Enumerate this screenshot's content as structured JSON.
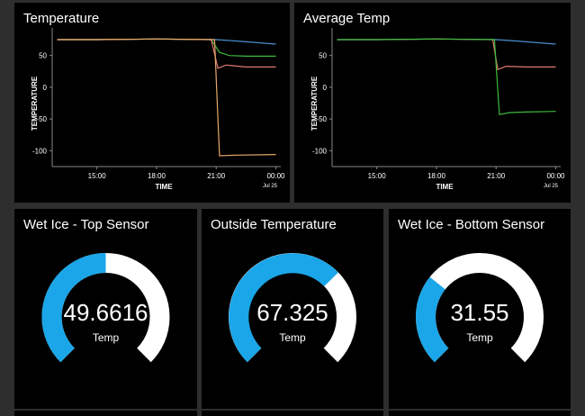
{
  "colors": {
    "background": "#000000",
    "gauge_fill": "#1aa6e8",
    "gauge_track": "#ffffff",
    "series_blue": "#4a8fd1",
    "series_green": "#3dbb3d",
    "series_red": "#e07a72",
    "series_orange": "#e8a86a"
  },
  "charts": [
    {
      "title": "Temperature",
      "xlabel": "TIME",
      "ylabel": "TEMPERATURE",
      "date_label": "Jul 25"
    },
    {
      "title": "Average Temp",
      "xlabel": "TIME",
      "ylabel": "TEMPERATURE",
      "date_label": "Jul 25"
    }
  ],
  "chart_data": [
    {
      "type": "line",
      "title": "Temperature",
      "xlabel": "TIME",
      "ylabel": "TEMPERATURE",
      "x_ticks": [
        "15:00",
        "18:00",
        "21:00",
        "00:00"
      ],
      "x_date_label": "Jul 25",
      "xlim": [
        "12:45",
        "00:15"
      ],
      "y_ticks": [
        50,
        0,
        -50,
        -100
      ],
      "ylim": [
        -125,
        85
      ],
      "grid": false,
      "series": [
        {
          "color": "#4a8fd1",
          "points": [
            [
              "13:00",
              75
            ],
            [
              "15:00",
              75
            ],
            [
              "18:00",
              76
            ],
            [
              "21:00",
              75
            ],
            [
              "22:00",
              73
            ],
            [
              "00:00",
              68
            ]
          ]
        },
        {
          "color": "#3dbb3d",
          "points": [
            [
              "13:00",
              75
            ],
            [
              "15:00",
              75
            ],
            [
              "18:00",
              76
            ],
            [
              "20:45",
              75
            ],
            [
              "21:10",
              55
            ],
            [
              "21:40",
              50
            ],
            [
              "22:30",
              49
            ],
            [
              "00:00",
              49
            ]
          ]
        },
        {
          "color": "#e07a72",
          "points": [
            [
              "13:00",
              75
            ],
            [
              "15:00",
              75
            ],
            [
              "18:00",
              76
            ],
            [
              "20:45",
              75
            ],
            [
              "21:05",
              30
            ],
            [
              "21:30",
              35
            ],
            [
              "22:30",
              32
            ],
            [
              "00:00",
              32
            ]
          ]
        },
        {
          "color": "#e8a86a",
          "points": [
            [
              "13:00",
              75
            ],
            [
              "15:00",
              75
            ],
            [
              "18:00",
              76
            ],
            [
              "20:55",
              75
            ],
            [
              "21:10",
              -108
            ],
            [
              "22:00",
              -107
            ],
            [
              "00:00",
              -106
            ]
          ]
        }
      ]
    },
    {
      "type": "line",
      "title": "Average Temp",
      "xlabel": "TIME",
      "ylabel": "TEMPERATURE",
      "x_ticks": [
        "15:00",
        "18:00",
        "21:00",
        "00:00"
      ],
      "x_date_label": "Jul 25",
      "xlim": [
        "12:45",
        "00:15"
      ],
      "y_ticks": [
        50,
        0,
        -50,
        -100
      ],
      "ylim": [
        -125,
        85
      ],
      "grid": false,
      "series": [
        {
          "color": "#4a8fd1",
          "points": [
            [
              "13:00",
              75
            ],
            [
              "15:00",
              75
            ],
            [
              "18:00",
              76
            ],
            [
              "21:00",
              75
            ],
            [
              "22:00",
              73
            ],
            [
              "00:00",
              68
            ]
          ]
        },
        {
          "color": "#e07a72",
          "points": [
            [
              "13:00",
              75
            ],
            [
              "15:00",
              75
            ],
            [
              "18:00",
              76
            ],
            [
              "20:50",
              75
            ],
            [
              "21:05",
              28
            ],
            [
              "21:30",
              33
            ],
            [
              "22:30",
              32
            ],
            [
              "00:00",
              32
            ]
          ]
        },
        {
          "color": "#3dbb3d",
          "points": [
            [
              "13:00",
              75
            ],
            [
              "15:00",
              75
            ],
            [
              "18:00",
              76
            ],
            [
              "20:55",
              75
            ],
            [
              "21:10",
              -43
            ],
            [
              "21:40",
              -40
            ],
            [
              "22:30",
              -39
            ],
            [
              "00:00",
              -38
            ]
          ]
        }
      ]
    }
  ],
  "gauges": [
    {
      "title": "Wet Ice - Top Sensor",
      "value": "49.6616",
      "unit": "Temp",
      "fraction": 0.5
    },
    {
      "title": "Outside Temperature",
      "value": "67.325",
      "unit": "Temp",
      "fraction": 0.67
    },
    {
      "title": "Wet Ice - Bottom Sensor",
      "value": "31.55",
      "unit": "Temp",
      "fraction": 0.31
    }
  ]
}
